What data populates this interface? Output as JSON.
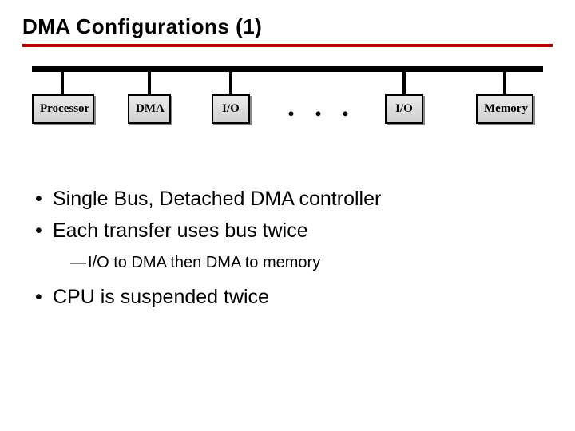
{
  "title": "DMA Configurations (1)",
  "diagram": {
    "boxes": [
      "Processor",
      "DMA",
      "I/O",
      "I/O",
      "Memory"
    ],
    "ellipsis": ". . ."
  },
  "bullets": {
    "items": [
      "Single Bus, Detached DMA controller",
      "Each transfer uses bus twice"
    ],
    "sub": "I/O to DMA then DMA to memory",
    "items2": [
      "CPU is suspended twice"
    ]
  },
  "glyphs": {
    "bullet": "•",
    "dash": "—"
  }
}
